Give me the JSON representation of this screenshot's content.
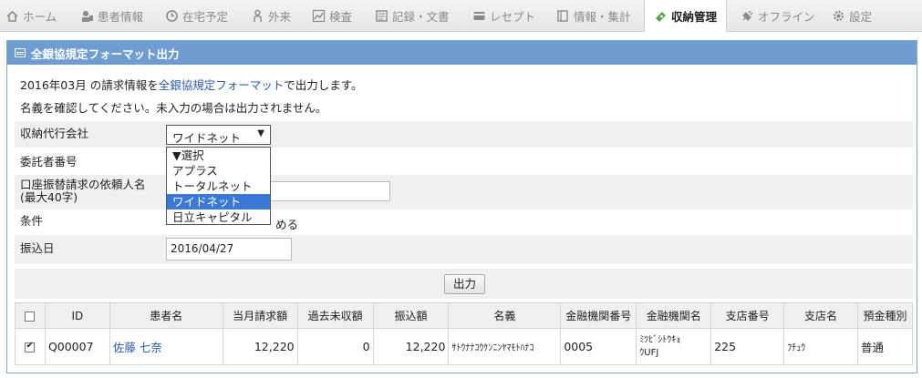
{
  "nav": [
    {
      "label": "ホーム",
      "icon": "home-icon"
    },
    {
      "label": "患者情報",
      "icon": "user-icon"
    },
    {
      "label": "在宅予定",
      "icon": "clock-icon"
    },
    {
      "label": "外来",
      "icon": "person-icon"
    },
    {
      "label": "検査",
      "icon": "chart-icon"
    },
    {
      "label": "記録・文書",
      "icon": "document-icon"
    },
    {
      "label": "レセプト",
      "icon": "card-icon"
    },
    {
      "label": "情報・集計",
      "icon": "book-icon"
    },
    {
      "label": "収納管理",
      "icon": "money-icon",
      "active": true
    },
    {
      "label": "オフライン",
      "icon": "plug-icon"
    },
    {
      "label": "設定",
      "icon": "gear-icon"
    }
  ],
  "panel": {
    "title": "全銀協規定フォーマット出力",
    "intro_prefix": "2016年03月 の請求情報を",
    "intro_link": "全銀協規定フォーマット",
    "intro_suffix": "で出力します。",
    "note": "名義を確認してください。未入力の場合は出力されません。"
  },
  "form": {
    "agency_label": "収納代行会社",
    "agency_selected": "ワイドネット",
    "agency_options": [
      "▼選択",
      "アプラス",
      "トータルネット",
      "ワイドネット",
      "日立キャピタル"
    ],
    "consignor_label": "委託者番号",
    "requester_label_1": "口座振替請求の依頼人名",
    "requester_label_2": "(最大40字)",
    "condition_label": "条件",
    "condition_text": "める",
    "date_label": "振込日",
    "date_value": "2016/04/27",
    "output_button": "出力"
  },
  "table": {
    "headers": [
      "ID",
      "患者名",
      "当月請求額",
      "過去未収額",
      "振込額",
      "名義",
      "金融機関番号",
      "金融機関名",
      "支店番号",
      "支店名",
      "預金種別"
    ],
    "rows": [
      {
        "checked": true,
        "id": "Q00007",
        "patient": "佐藤 七奈",
        "current": "12,220",
        "past": "0",
        "transfer": "12,220",
        "holder": "ｻﾄｳﾅﾅｺｳｹﾝﾆﾝﾔﾏﾓﾄﾊﾅｺ",
        "bank_no": "0005",
        "bank_name_1": "ﾐﾂﾋﾞｼﾄｳｷｮ",
        "bank_name_2": "ｳUFJ",
        "branch_no": "225",
        "branch_name": "ﾌﾁｭｳ",
        "account_type": "普通"
      }
    ]
  },
  "colors": {
    "panel_header": "#6f9dd1",
    "link": "#2a5db0",
    "selected_option": "#3b78d8"
  }
}
